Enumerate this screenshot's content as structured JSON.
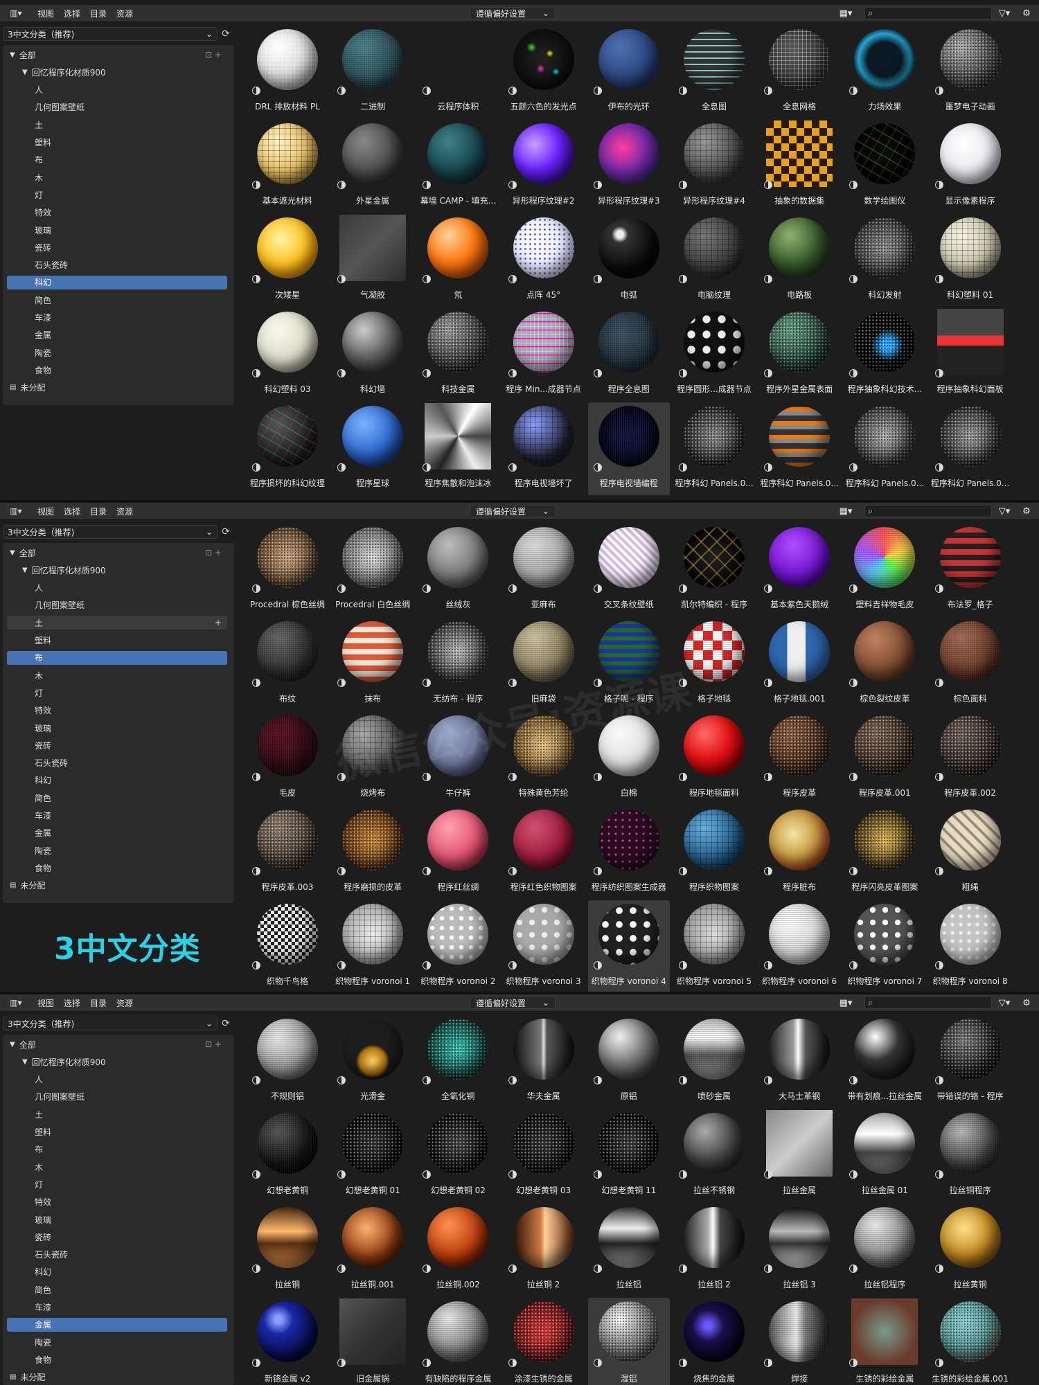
{
  "header": {
    "menus": [
      "视图",
      "选择",
      "目录",
      "资源"
    ],
    "import_method": "遵循偏好设置"
  },
  "sidebar": {
    "library": "3中文分类（推荐)",
    "root": "全部",
    "lib_root": "回忆程序化材质900",
    "categories": [
      "人",
      "几何图案壁纸",
      "土",
      "塑料",
      "布",
      "木",
      "灯",
      "特效",
      "玻璃",
      "瓷砖",
      "石头瓷砖",
      "科幻",
      "简色",
      "车漆",
      "金属",
      "陶瓷",
      "食物"
    ],
    "unassigned": "未分配"
  },
  "overlay_label": "3中文分类",
  "watermark": "微信公众号:资源课",
  "panels": [
    {
      "selected_category": "科幻",
      "hover_category": "",
      "materials": [
        {
          "name": "DRL 排放材料 PL",
          "look": "wire-white"
        },
        {
          "name": "二进制",
          "look": "binary-teal"
        },
        {
          "name": "云程序体积",
          "look": "empty"
        },
        {
          "name": "五颜六色的发光点",
          "look": "glow-dots"
        },
        {
          "name": "伊布的光环",
          "look": "blue"
        },
        {
          "name": "全息图",
          "look": "holo-rings"
        },
        {
          "name": "全息网格",
          "look": "holo-grid"
        },
        {
          "name": "力场效果",
          "look": "forcefield"
        },
        {
          "name": "噩梦电子动画",
          "look": "nightmare"
        },
        {
          "name": "基本遮光材料",
          "look": "gold-grid"
        },
        {
          "name": "外星金属",
          "look": "alien-metal"
        },
        {
          "name": "幕墙 CAMP - 填充...",
          "look": "teal-dark"
        },
        {
          "name": "异形程序纹理#2",
          "look": "purple-swirl"
        },
        {
          "name": "异形程序纹理#3",
          "look": "magenta"
        },
        {
          "name": "异形程序纹理#4",
          "look": "scifi-panel"
        },
        {
          "name": "抽象的数据集",
          "look": "data-squares"
        },
        {
          "name": "数学绘图仪",
          "look": "math"
        },
        {
          "name": "显示像素程序",
          "look": "white"
        },
        {
          "name": "次矮星",
          "look": "sun"
        },
        {
          "name": "气凝胶",
          "look": "aerogel"
        },
        {
          "name": "氖",
          "look": "orange"
        },
        {
          "name": "点阵 45°",
          "look": "dots-blue"
        },
        {
          "name": "电弧",
          "look": "black-gloss"
        },
        {
          "name": "电脑纹理",
          "look": "computer"
        },
        {
          "name": "电路板",
          "look": "green-board"
        },
        {
          "name": "科幻发射",
          "look": "noise"
        },
        {
          "name": "科幻塑料 01",
          "look": "cream"
        },
        {
          "name": "科幻塑料 03",
          "look": "cream-light"
        },
        {
          "name": "科幻墙",
          "look": "scifi-wall"
        },
        {
          "name": "科技金属",
          "look": "tech-metal"
        },
        {
          "name": "程序 Min...成器节点",
          "look": "min-node"
        },
        {
          "name": "程序全息图",
          "look": "holo-dark"
        },
        {
          "name": "程序圆形...成器节点",
          "look": "circle-node"
        },
        {
          "name": "程序外星金属表面",
          "look": "alien-surface"
        },
        {
          "name": "程序抽象科幻技术...",
          "look": "abstract-scifi"
        },
        {
          "name": "程序抽象科幻面板",
          "look": "scifi-face"
        },
        {
          "name": "程序损坏的科幻纹理",
          "look": "damaged"
        },
        {
          "name": "程序星球",
          "look": "planet"
        },
        {
          "name": "程序焦散和泡沫冰",
          "look": "caustic"
        },
        {
          "name": "程序电视墙坏了",
          "look": "tv-broken"
        },
        {
          "name": "程序电视墙编程",
          "look": "tv-wall"
        },
        {
          "name": "程序科幻 Panels.0...",
          "look": "panel-a"
        },
        {
          "name": "程序科幻 Panels.0...",
          "look": "panel-b"
        },
        {
          "name": "程序科幻 Panels.0...",
          "look": "panel-c"
        },
        {
          "name": "程序科幻 Panels.0...",
          "look": "panel-d"
        }
      ],
      "active_index": 40
    },
    {
      "selected_category": "布",
      "hover_category": "土",
      "materials": [
        {
          "name": "Procedral 棕色丝绸",
          "look": "brown-silk"
        },
        {
          "name": "Procedral 白色丝绸",
          "look": "white-silk"
        },
        {
          "name": "丝绒灰",
          "look": "velvet-grey"
        },
        {
          "name": "亚麻布",
          "look": "linen"
        },
        {
          "name": "交叉条纹壁纸",
          "look": "cross-stripe"
        },
        {
          "name": "凯尔特编织 - 程序",
          "look": "celtic"
        },
        {
          "name": "基本紫色天鹅绒",
          "look": "purple-cloth"
        },
        {
          "name": "塑料吉祥物毛皮",
          "look": "rainbow"
        },
        {
          "name": "布法罗_格子",
          "look": "buffalo"
        },
        {
          "name": "布纹",
          "look": "cloth-dark"
        },
        {
          "name": "抹布",
          "look": "rag"
        },
        {
          "name": "无纺布 - 程序",
          "look": "nonwoven"
        },
        {
          "name": "旧麻袋",
          "look": "sack"
        },
        {
          "name": "格子呢 - 程序",
          "look": "tartan"
        },
        {
          "name": "格子地毯",
          "look": "red-carpet"
        },
        {
          "name": "格子地毯.001",
          "look": "blue-white"
        },
        {
          "name": "棕色裂纹皮革",
          "look": "brown-leather"
        },
        {
          "name": "棕色面料",
          "look": "brown-fabric"
        },
        {
          "name": "毛皮",
          "look": "fur"
        },
        {
          "name": "烧烤布",
          "look": "grill"
        },
        {
          "name": "牛仔裤",
          "look": "denim"
        },
        {
          "name": "特殊黄色芳纶",
          "look": "aramid"
        },
        {
          "name": "白棉",
          "look": "white-cotton"
        },
        {
          "name": "程序地毯面料",
          "look": "red"
        },
        {
          "name": "程序皮革",
          "look": "leather"
        },
        {
          "name": "程序皮革.001",
          "look": "leather-dark"
        },
        {
          "name": "程序皮革.002",
          "look": "leather-grey"
        },
        {
          "name": "程序皮革.003",
          "look": "leather-grey2"
        },
        {
          "name": "程序磨损的皮革",
          "look": "worn-leather"
        },
        {
          "name": "程序红丝绸",
          "look": "pink"
        },
        {
          "name": "程序红色织物图案",
          "look": "red-fabric"
        },
        {
          "name": "程序纺织图案生成器",
          "look": "textile"
        },
        {
          "name": "程序织物图案",
          "look": "fabric-blue"
        },
        {
          "name": "程序脏布",
          "look": "dirty"
        },
        {
          "name": "程序闪亮皮革图案",
          "look": "shiny-leather"
        },
        {
          "name": "粗绳",
          "look": "rope"
        },
        {
          "name": "织物千鸟格",
          "look": "houndstooth"
        },
        {
          "name": "织物程序 voronoi 1",
          "look": "voronoi-1"
        },
        {
          "name": "织物程序 voronoi 2",
          "look": "voronoi-2"
        },
        {
          "name": "织物程序 voronoi 3",
          "look": "voronoi-3"
        },
        {
          "name": "织物程序 voronoi 4",
          "look": "voronoi-4"
        },
        {
          "name": "织物程序 voronoi 5",
          "look": "voronoi-5"
        },
        {
          "name": "织物程序 voronoi 6",
          "look": "voronoi-6"
        },
        {
          "name": "织物程序 voronoi 7",
          "look": "voronoi-7"
        },
        {
          "name": "织物程序 voronoi 8",
          "look": "voronoi-8"
        }
      ],
      "active_index": 40
    },
    {
      "selected_category": "金属",
      "hover_category": "",
      "materials": [
        {
          "name": "不规则铝",
          "look": "irreg-alu"
        },
        {
          "name": "光滑金",
          "look": "gold-crown"
        },
        {
          "name": "全氧化铜",
          "look": "oxide"
        },
        {
          "name": "华夫金属",
          "look": "waffle"
        },
        {
          "name": "原铝",
          "look": "raw-alu"
        },
        {
          "name": "喷砂金属",
          "look": "sandblast"
        },
        {
          "name": "大马士革钢",
          "look": "damascus"
        },
        {
          "name": "带有划痕...拉丝金属",
          "look": "scratched"
        },
        {
          "name": "带错误的铬 - 程序",
          "look": "chrome-err"
        },
        {
          "name": "幻想老黄铜",
          "look": "fantasy-0"
        },
        {
          "name": "幻想老黄铜 01",
          "look": "fantasy-1"
        },
        {
          "name": "幻想老黄铜 02",
          "look": "fantasy-2"
        },
        {
          "name": "幻想老黄铜 03",
          "look": "fantasy-3"
        },
        {
          "name": "幻想老黄铜 11",
          "look": "fantasy-4"
        },
        {
          "name": "拉丝不锈钢",
          "look": "stainless"
        },
        {
          "name": "拉丝金属",
          "look": "brushed-cube"
        },
        {
          "name": "拉丝金属 01",
          "look": "brushed-01"
        },
        {
          "name": "拉丝铜程序",
          "look": "copper-prog"
        },
        {
          "name": "拉丝铜",
          "look": "copper"
        },
        {
          "name": "拉丝铜.001",
          "look": "copper-001"
        },
        {
          "name": "拉丝铜.002",
          "look": "copper-002"
        },
        {
          "name": "拉丝铜 2",
          "look": "copper-2"
        },
        {
          "name": "拉丝铝",
          "look": "alu"
        },
        {
          "name": "拉丝铝 2",
          "look": "alu-2"
        },
        {
          "name": "拉丝铝 3",
          "look": "alu-3"
        },
        {
          "name": "拉丝铝程序",
          "look": "alu-prog"
        },
        {
          "name": "拉丝黄铜",
          "look": "brass"
        },
        {
          "name": "新铬金属 v2",
          "look": "chrome-blue"
        },
        {
          "name": "旧金属锅",
          "look": "old-pot"
        },
        {
          "name": "有缺陷的程序金属",
          "look": "defect"
        },
        {
          "name": "涂漆生锈的金属",
          "look": "painted-rust"
        },
        {
          "name": "湿铝",
          "look": "wet-alu"
        },
        {
          "name": "烧焦的金属",
          "look": "burnt"
        },
        {
          "name": "焊接",
          "look": "weld"
        },
        {
          "name": "生锈的彩绘金属",
          "look": "rust-paint"
        },
        {
          "name": "生锈的彩绘金属.001",
          "look": "rust-paint-2"
        }
      ],
      "active_index": 31
    }
  ]
}
